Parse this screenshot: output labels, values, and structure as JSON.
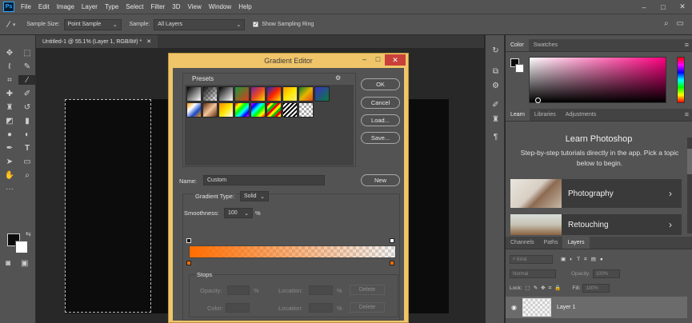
{
  "menubar": {
    "logo": "Ps",
    "items": [
      "File",
      "Edit",
      "Image",
      "Layer",
      "Type",
      "Select",
      "Filter",
      "3D",
      "View",
      "Window",
      "Help"
    ],
    "window_controls": [
      "–",
      "□",
      "✕"
    ]
  },
  "options_bar": {
    "sample_size_label": "Sample Size:",
    "sample_size_value": "Point Sample",
    "sample_label": "Sample:",
    "sample_value": "All Layers",
    "sampling_ring_label": "Show Sampling Ring",
    "sampling_ring_checked": true
  },
  "document": {
    "tab_title": "Untitled-1 @ 55.1% (Layer 1, RGB/8#) *",
    "tab_close": "✕"
  },
  "gradient_editor": {
    "title": "Gradient Editor",
    "presets_label": "Presets",
    "ok_label": "OK",
    "cancel_label": "Cancel",
    "load_label": "Load...",
    "save_label": "Save...",
    "name_label": "Name:",
    "name_value": "Custom",
    "new_label": "New",
    "gradient_type_label": "Gradient Type:",
    "gradient_type_value": "Solid",
    "smoothness_label": "Smoothness:",
    "smoothness_value": "100",
    "smoothness_unit": "%",
    "gradient_start_color": "#ff6d00",
    "stops": {
      "label": "Stops",
      "opacity_label": "Opacity:",
      "opacity_unit": "%",
      "location_label": "Location:",
      "location_unit": "%",
      "color_label": "Color:",
      "delete_label": "Delete"
    }
  },
  "panels": {
    "color_tabs": [
      "Color",
      "Swatches"
    ],
    "learn_tabs": [
      "Learn",
      "Libraries",
      "Adjustments"
    ],
    "learn_title": "Learn Photoshop",
    "learn_subtitle": "Step-by-step tutorials directly in the app. Pick a topic below to begin.",
    "learn_cards": [
      "Photography",
      "Retouching"
    ],
    "layers_tabs": [
      "Channels",
      "Paths",
      "Layers"
    ],
    "layers_filter": "Kind",
    "blend_mode": "Normal",
    "opacity_label": "Opacity:",
    "opacity_value": "100%",
    "lock_label": "Lock:",
    "fill_label": "Fill:",
    "fill_value": "100%",
    "layer_name": "Layer 1"
  }
}
